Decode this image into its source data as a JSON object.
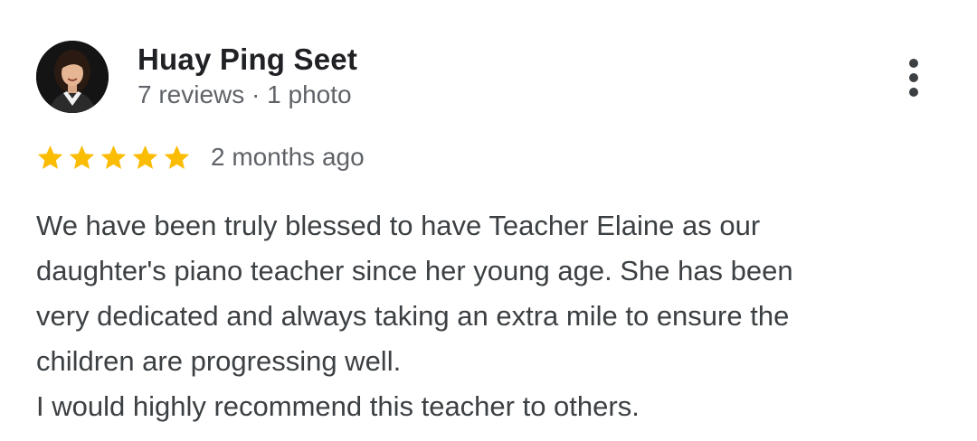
{
  "review": {
    "author_name": "Huay Ping Seet",
    "author_meta": "7 reviews · 1 photo",
    "avatar_icon": "profile-photo",
    "rating": 5,
    "rating_max": 5,
    "star_color": "#fbbc04",
    "date": "2 months ago",
    "text_lines": [
      "We have been truly blessed to have Teacher Elaine as our",
      "daughter's piano teacher since her young age. She has been",
      "very dedicated and always taking an extra mile to ensure the",
      "children are progressing well.",
      "I would highly recommend this teacher to others."
    ],
    "more_icon": "more-vert-icon"
  }
}
